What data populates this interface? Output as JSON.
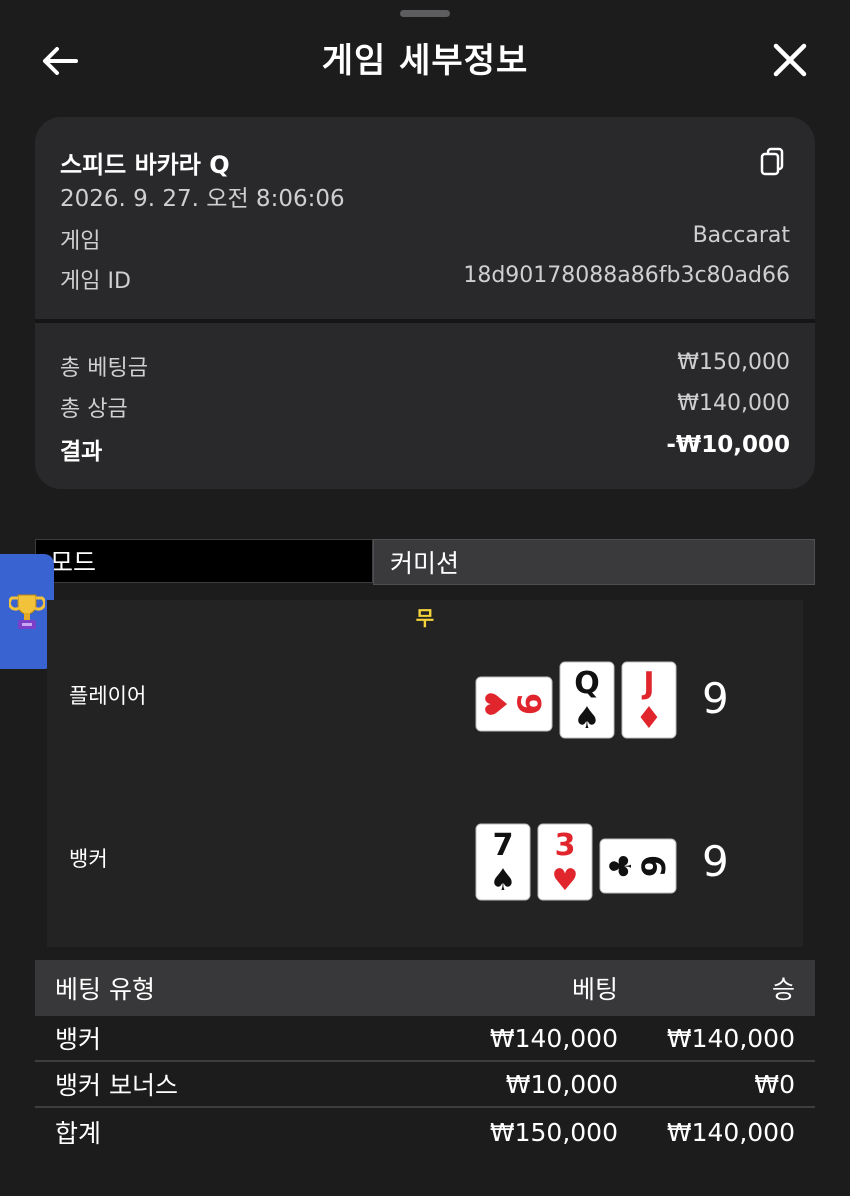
{
  "header": {
    "title": "게임 세부정보"
  },
  "game": {
    "name": "스피드 바카라 Q",
    "datetime": "2026. 9. 27. 오전 8:06:06",
    "type_label": "게임",
    "type_value": "Baccarat",
    "id_label": "게임 ID",
    "id_value": "18d90178088a86fb3c80ad66"
  },
  "summary": {
    "total_bet_label": "총 베팅금",
    "total_bet_value": "₩150,000",
    "total_win_label": "총 상금",
    "total_win_value": "₩140,000",
    "result_label": "결과",
    "result_value": "-₩10,000"
  },
  "mode": {
    "label": "모드",
    "value": "커미션"
  },
  "round": {
    "outcome": "무",
    "player": {
      "label": "플레이어",
      "score": "9",
      "cards": [
        {
          "rank": "6",
          "suit": "hearts",
          "color": "#e0262c",
          "orientation": "sideways"
        },
        {
          "rank": "Q",
          "suit": "spades",
          "color": "#111111",
          "orientation": "upright"
        },
        {
          "rank": "J",
          "suit": "diamonds",
          "color": "#e0262c",
          "orientation": "upright"
        }
      ]
    },
    "banker": {
      "label": "뱅커",
      "score": "9",
      "cards": [
        {
          "rank": "7",
          "suit": "spades",
          "color": "#111111",
          "orientation": "upright"
        },
        {
          "rank": "3",
          "suit": "hearts",
          "color": "#e0262c",
          "orientation": "upright"
        },
        {
          "rank": "9",
          "suit": "clubs",
          "color": "#111111",
          "orientation": "sideways"
        }
      ]
    }
  },
  "bets": {
    "headers": [
      "베팅 유형",
      "베팅",
      "승"
    ],
    "rows": [
      [
        "뱅커",
        "₩140,000",
        "₩140,000"
      ],
      [
        "뱅커 보너스",
        "₩10,000",
        "₩0"
      ]
    ],
    "total": [
      "합계",
      "₩150,000",
      "₩140,000"
    ]
  },
  "icons": {
    "back": "arrow-left-icon",
    "close": "close-icon",
    "copy": "copy-icon",
    "trophy": "trophy-icon"
  }
}
